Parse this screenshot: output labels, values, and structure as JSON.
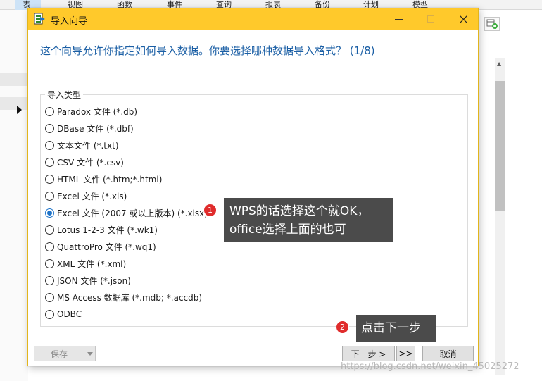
{
  "background": {
    "menu_items": [
      "表",
      "视图",
      "函数",
      "事件",
      "查询",
      "报表",
      "备份",
      "计划",
      "模型"
    ]
  },
  "dialog": {
    "title": "导入向导",
    "question": "这个向导允许你指定如何导入数据。你要选择哪种数据导入格式？ (1/8)",
    "group_label": "导入类型",
    "options": [
      {
        "label": "Paradox 文件 (*.db)",
        "checked": false
      },
      {
        "label": "DBase 文件 (*.dbf)",
        "checked": false
      },
      {
        "label": "文本文件 (*.txt)",
        "checked": false
      },
      {
        "label": "CSV 文件 (*.csv)",
        "checked": false
      },
      {
        "label": "HTML 文件 (*.htm;*.html)",
        "checked": false
      },
      {
        "label": "Excel 文件 (*.xls)",
        "checked": false
      },
      {
        "label": "Excel 文件 (2007 或以上版本) (*.xlsx)",
        "checked": true
      },
      {
        "label": "Lotus 1-2-3 文件 (*.wk1)",
        "checked": false
      },
      {
        "label": "QuattroPro 文件 (*.wq1)",
        "checked": false
      },
      {
        "label": "XML 文件 (*.xml)",
        "checked": false
      },
      {
        "label": "JSON 文件 (*.json)",
        "checked": false
      },
      {
        "label": "MS Access 数据库 (*.mdb; *.accdb)",
        "checked": false
      },
      {
        "label": "ODBC",
        "checked": false
      }
    ],
    "buttons": {
      "save": "保存",
      "next": "下一步 >",
      "fast_forward": ">>",
      "cancel": "取消"
    }
  },
  "annotations": {
    "callout_1": {
      "badge": "1",
      "line1": "WPS的话选择这个就OK，",
      "line2": "office选择上面的也可"
    },
    "callout_2": {
      "badge": "2",
      "text": "点击下一步"
    }
  },
  "watermark": "https://blog.csdn.net/weixin_45025272",
  "colors": {
    "titlebar": "#ffc92b",
    "question_text": "#1b5fa5",
    "radio_checked": "#1d73c9",
    "callout_bg": "#4b4b4b",
    "badge_bg": "#e02c2c"
  }
}
